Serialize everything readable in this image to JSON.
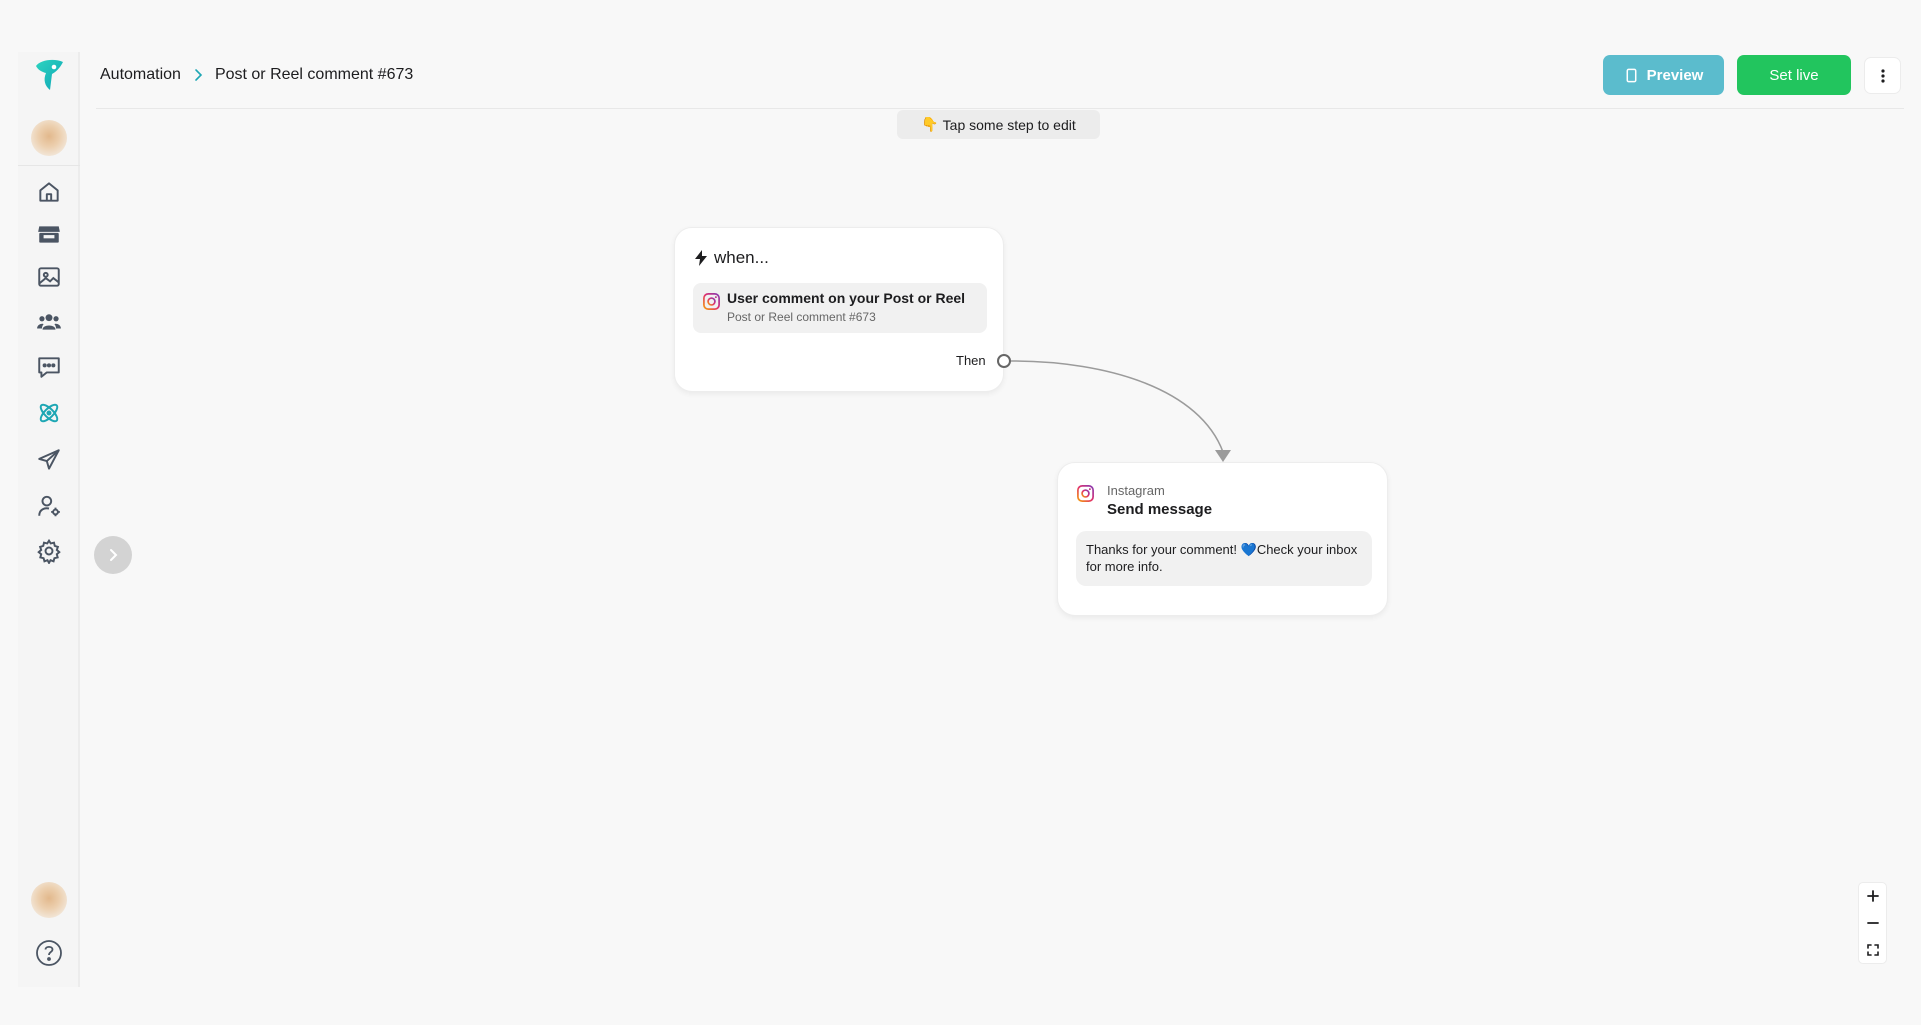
{
  "breadcrumb": {
    "root": "Automation",
    "current": "Post or Reel comment #673"
  },
  "header": {
    "preview_label": "Preview",
    "set_live_label": "Set live"
  },
  "hint": {
    "emoji": "👇",
    "text": "Tap some step to edit"
  },
  "sidebar": {
    "items": [
      {
        "icon": "home-icon"
      },
      {
        "icon": "store-icon"
      },
      {
        "icon": "image-icon"
      },
      {
        "icon": "users-icon"
      },
      {
        "icon": "chat-icon"
      },
      {
        "icon": "atom-icon",
        "active": true
      },
      {
        "icon": "send-icon"
      },
      {
        "icon": "user-settings-icon"
      },
      {
        "icon": "gear-icon"
      }
    ]
  },
  "trigger": {
    "heading": "when...",
    "title": "User comment on your Post or Reel",
    "subtitle": "Post or Reel comment #673",
    "then_label": "Then"
  },
  "action": {
    "platform": "Instagram",
    "title": "Send message",
    "message_part1": "Thanks for your comment! ",
    "message_heart": "💙",
    "message_part2": "Check your inbox for more info."
  },
  "colors": {
    "accent": "#1ea7b4",
    "preview_bg": "#5bbccd",
    "set_live_bg": "#22c55e"
  }
}
